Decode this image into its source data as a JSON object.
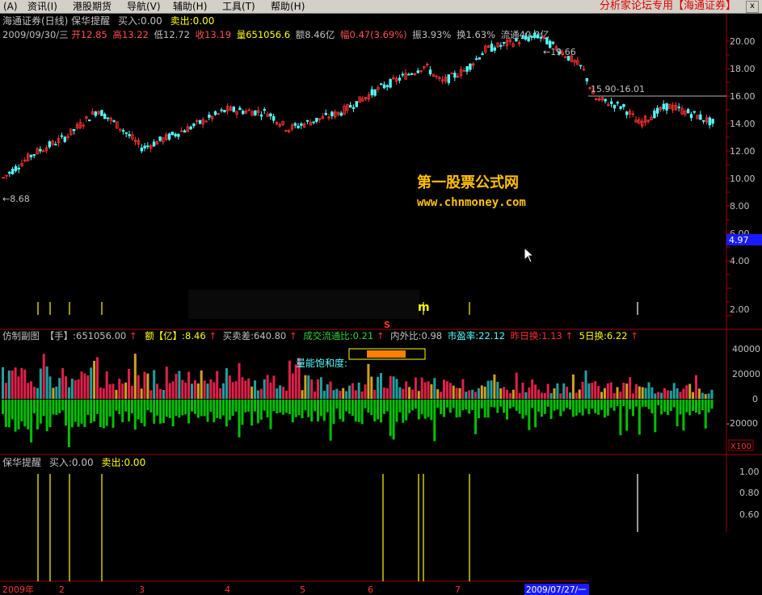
{
  "menu": {
    "items": [
      {
        "id": "a",
        "label": "(A)"
      },
      {
        "id": "info",
        "label": "资讯(I)"
      },
      {
        "id": "hk",
        "label": "港股期货"
      },
      {
        "id": "nav",
        "label": "导航(V)"
      },
      {
        "id": "assist",
        "label": "辅助(H)"
      },
      {
        "id": "tools",
        "label": "工具(T)"
      },
      {
        "id": "help",
        "label": "帮助(H)"
      }
    ],
    "right_text": "分析家论坛专用【海通证券】",
    "close_label": "x"
  },
  "main_panel": {
    "title": "海通证券(日线) 保华提醒",
    "buy_label": "买入:0.00",
    "sell_label": "卖出:0.00",
    "info_date": "2009/09/30/三",
    "info_open": "开12.85",
    "info_high": "高13.22",
    "info_low": "低12.72",
    "info_close": "收13.19",
    "info_volume": "量651056.6",
    "info_amount": "额8.46亿",
    "info_change": "幅0.47(3.69%)",
    "info_amplitude": "振3.93%",
    "info_turnover": "换1.63%",
    "info_float": "流通40.0亿",
    "watermark_title": "第一股票公式网",
    "watermark_url": "www.chnmoney.com",
    "marker_high": "19.66",
    "marker_low": "8.68",
    "marker_range": "15.90-16.01",
    "price_tag": "4.97",
    "marker_s": "S",
    "marker_m": "m",
    "y_ticks": [
      "20.00",
      "18.00",
      "16.00",
      "14.00",
      "12.00",
      "10.00",
      "8.00",
      "6.00",
      "4.00",
      "2.00"
    ]
  },
  "volume_panel": {
    "title": "仿制副图",
    "field_hand": "【手】:651056.00",
    "field_amount": "额【亿】:8.46",
    "field_diff": "买卖差:640.80",
    "field_ratio": "成交流通比:0.21",
    "field_inout": "内外比:0.98",
    "field_pe": "市盈率:22.12",
    "field_yesterday": "昨日换:1.13",
    "field_5day": "5日换:6.22",
    "label_energy": "量能饱和度:",
    "unit": "X100",
    "y_ticks": [
      "40000",
      "20000",
      "0",
      "-20000"
    ]
  },
  "signal_panel": {
    "title": "保华提醒",
    "buy_label": "买入:0.00",
    "sell_label": "卖出:0.00",
    "y_ticks": [
      "1.00",
      "0.80",
      "0.60"
    ]
  },
  "time_axis": {
    "labels": [
      "2009年",
      "2",
      "3",
      "4",
      "5",
      "6",
      "7"
    ],
    "current_date": "2009/07/27/一"
  },
  "colors": {
    "up": "#ff3232",
    "down": "#54fcfc",
    "volume_neg": "#00c000",
    "volume_pos": "#e0204a",
    "volume_teal": "#20a0a0",
    "signal": "#ffff00",
    "frame": "#a00000",
    "text": "#c0c0c0"
  }
}
